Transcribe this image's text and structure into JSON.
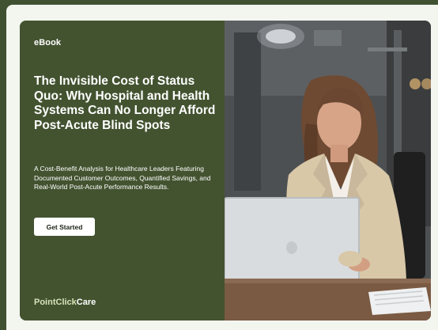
{
  "card": {
    "eyebrow": "eBook",
    "title": "The Invisible Cost of Status Quo: Why Hospital and Health Systems Can No Longer Afford Post-Acute Blind Spots",
    "subtitle": "A Cost-Benefit Analysis for Healthcare Leaders Featuring Documented Customer Outcomes, Quantified Savings, and Real-World Post-Acute Performance Results.",
    "cta_label": "Get Started",
    "logo": {
      "part1": "PointClick",
      "part2": "Care"
    }
  },
  "colors": {
    "background_green": "#435330",
    "page_green": "#3f5131",
    "frame": "#f3f5ef",
    "logo_accent": "#d6e2b8",
    "button_bg": "#ffffff"
  }
}
